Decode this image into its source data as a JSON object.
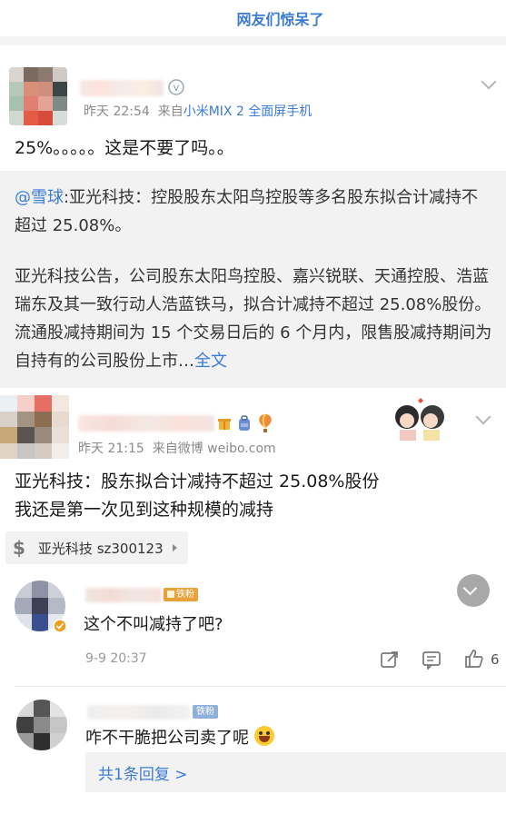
{
  "banner": {
    "text": "网友们惊呆了"
  },
  "post1": {
    "time": "昨天 22:54",
    "source_prefix": "来自",
    "source": "小米MIX 2 全面屏手机",
    "text": "25%。。。。。这是不要了吗。。"
  },
  "retweet": {
    "at": "@雪球",
    "lead": ":亚光科技：控股股东太阳鸟控股等多名股东拟合计减持不超过 25.08%。",
    "body": "亚光科技公告，公司股东太阳鸟控股、嘉兴锐联、天通控股、浩蓝瑞东及其一致行动人浩蓝铁马，拟合计减持不超过 25.08%股份。流通股减持期间为 15 个交易日后的 6 个月内，限售股减持期间为自持有的公司股份上市…",
    "more": "全文"
  },
  "post2": {
    "time": "昨天 21:15",
    "source_prefix": "来自",
    "source": "微博 weibo.com",
    "line1": "亚光科技：股东拟合计减持不超过 25.08%股份",
    "line2": "我还是第一次见到这种规模的减持",
    "stock": {
      "icon": "$",
      "label": "亚光科技 sz300123"
    }
  },
  "comments": [
    {
      "badge": "铁粉",
      "text": "这个不叫减持了吧?",
      "time": "9-9 20:37",
      "likes": "6"
    },
    {
      "badge": "铁粉",
      "text": "咋不干脆把公司卖了呢",
      "reply": "共1条回复 >"
    }
  ],
  "colors": {
    "link": "#3b7bd6",
    "badge_gold": "#e9a23b",
    "badge_blue": "#8fb0d8"
  }
}
